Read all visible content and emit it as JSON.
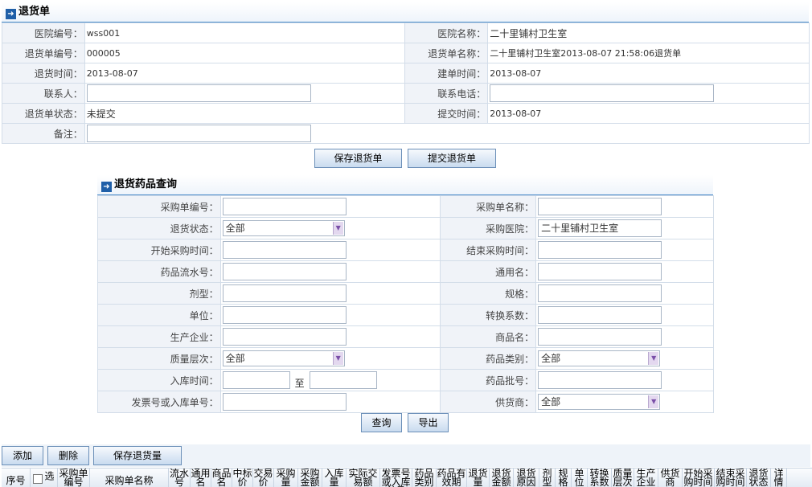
{
  "top": {
    "title": "退货单",
    "rows": [
      {
        "l1": "医院编号：",
        "v1": "wss001",
        "l2": "医院名称：",
        "v2": "二十里铺村卫生室"
      },
      {
        "l1": "退货单编号：",
        "v1": "000005",
        "l2": "退货单名称：",
        "v2": "二十里铺村卫生室2013-08-07 21:58:06退货单"
      },
      {
        "l1": "退货时间：",
        "v1": "2013-08-07",
        "l2": "建单时间：",
        "v2": "2013-08-07"
      },
      {
        "l1": "联系人：",
        "v1": "",
        "l2": "联系电话：",
        "v2": ""
      },
      {
        "l1": "退货单状态：",
        "v1": "未提交",
        "l2": "提交时间：",
        "v2": "2013-08-07"
      },
      {
        "l1": "备注：",
        "v1": ""
      }
    ],
    "save_btn": "保存退货单",
    "submit_btn": "提交退货单"
  },
  "query": {
    "title": "退货药品查询",
    "rows": [
      {
        "l1": "采购单编号：",
        "v1": "",
        "l2": "采购单名称：",
        "v2": ""
      },
      {
        "l1": "退货状态：",
        "v1": "全部",
        "l2": "采购医院：",
        "v2": "二十里铺村卫生室"
      },
      {
        "l1": "开始采购时间：",
        "v1": "",
        "l2": "结束采购时间：",
        "v2": ""
      },
      {
        "l1": "药品流水号：",
        "v1": "",
        "l2": "通用名：",
        "v2": ""
      },
      {
        "l1": "剂型：",
        "v1": "",
        "l2": "规格：",
        "v2": ""
      },
      {
        "l1": "单位：",
        "v1": "",
        "l2": "转换系数：",
        "v2": ""
      },
      {
        "l1": "生产企业：",
        "v1": "",
        "l2": "商品名：",
        "v2": ""
      },
      {
        "l1": "质量层次：",
        "v1": "全部",
        "l2": "药品类别：",
        "v2": "全部"
      },
      {
        "l1": "入库时间：",
        "v1": "",
        "to": "至",
        "v1b": "",
        "l2": "药品批号：",
        "v2": ""
      },
      {
        "l1": "发票号或入库单号：",
        "v1": "",
        "l2": "供货商：",
        "v2": "全部"
      }
    ],
    "search_btn": "查询",
    "export_btn": "导出"
  },
  "toolbar": {
    "add": "添加",
    "delete": "删除",
    "save_qty": "保存退货量"
  },
  "grid": {
    "columns": [
      "序号",
      "选",
      "采购单编号",
      "采购单名称",
      "流水号",
      "通用名",
      "商品名",
      "中标价",
      "交易价",
      "采购量",
      "采购金额",
      "入库量",
      "实际交易额",
      "发票号或入库单号",
      "药品类别",
      "药品有效期",
      "退货量",
      "退货金额",
      "退货原因",
      "剂型",
      "规格",
      "单位",
      "转换系数",
      "质量层次",
      "生产企业",
      "供货商",
      "开始采购时间",
      "结束采购时间",
      "退货状态",
      "详情"
    ]
  }
}
